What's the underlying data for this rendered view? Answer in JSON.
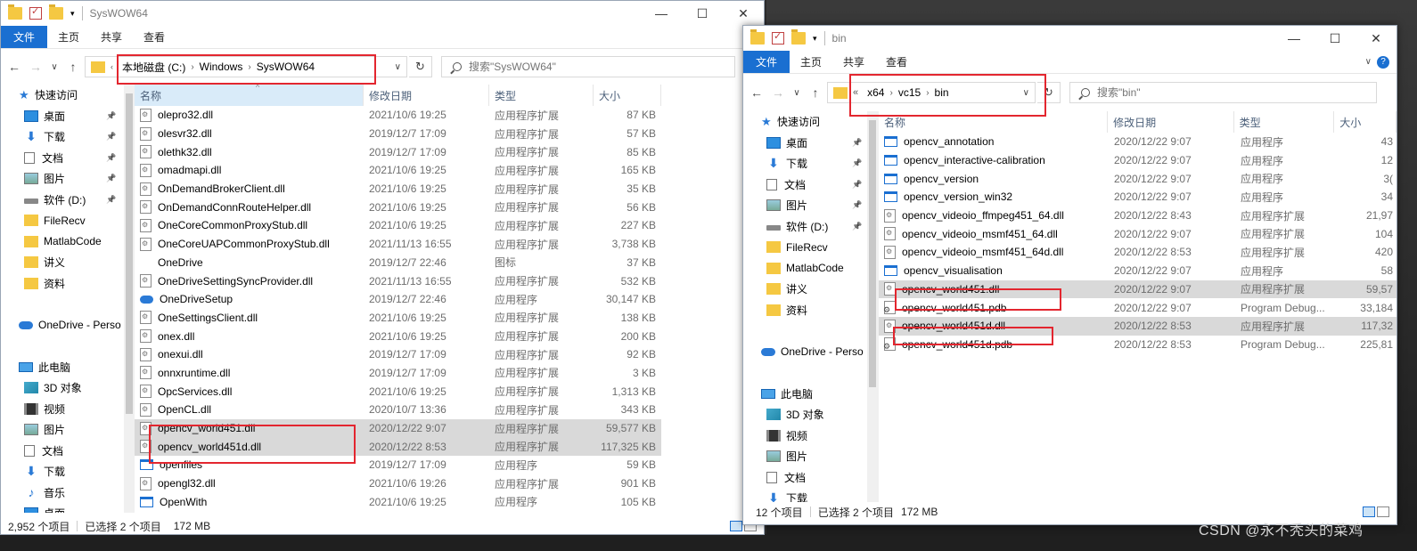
{
  "left_window": {
    "title": "SysWOW64",
    "ribbon": {
      "file": "文件",
      "tabs": [
        "主页",
        "共享",
        "查看"
      ]
    },
    "address": {
      "crumbs": [
        "本地磁盘 (C:)",
        "Windows",
        "SysWOW64"
      ]
    },
    "search_placeholder": "搜索\"SysWOW64\"",
    "columns": [
      "名称",
      "修改日期",
      "类型",
      "大小"
    ],
    "nav": [
      {
        "label": "快速访问",
        "icon": "star-icon",
        "pin": false
      },
      {
        "label": "桌面",
        "icon": "desktop-icon",
        "pin": true
      },
      {
        "label": "下载",
        "icon": "download-icon",
        "pin": true
      },
      {
        "label": "文档",
        "icon": "document-icon",
        "pin": true
      },
      {
        "label": "图片",
        "icon": "pictures-icon",
        "pin": true
      },
      {
        "label": "软件 (D:)",
        "icon": "drive-icon",
        "pin": true
      },
      {
        "label": "FileRecv",
        "icon": "folder-icon",
        "pin": false
      },
      {
        "label": "MatlabCode",
        "icon": "folder-icon",
        "pin": false
      },
      {
        "label": "讲义",
        "icon": "folder-icon",
        "pin": false
      },
      {
        "label": "资料",
        "icon": "folder-icon",
        "pin": false
      },
      {
        "label": "",
        "icon": "",
        "pin": false
      },
      {
        "label": "OneDrive - Perso",
        "icon": "cloud-icon",
        "pin": false
      },
      {
        "label": "",
        "icon": "",
        "pin": false
      },
      {
        "label": "此电脑",
        "icon": "pc-icon",
        "pin": false
      },
      {
        "label": "3D 对象",
        "icon": "3d-objects-icon",
        "pin": false
      },
      {
        "label": "视频",
        "icon": "video-icon",
        "pin": false
      },
      {
        "label": "图片",
        "icon": "pictures-icon",
        "pin": false
      },
      {
        "label": "文档",
        "icon": "document-icon",
        "pin": false
      },
      {
        "label": "下载",
        "icon": "download-icon",
        "pin": false
      },
      {
        "label": "音乐",
        "icon": "music-icon",
        "pin": false
      },
      {
        "label": "桌面",
        "icon": "desktop-icon",
        "pin": false
      }
    ],
    "files": [
      {
        "name": "olepro32.dll",
        "date": "2021/10/6 19:25",
        "type": "应用程序扩展",
        "size": "87 KB",
        "icon": "dll",
        "sel": false
      },
      {
        "name": "olesvr32.dll",
        "date": "2019/12/7 17:09",
        "type": "应用程序扩展",
        "size": "57 KB",
        "icon": "dll",
        "sel": false
      },
      {
        "name": "olethk32.dll",
        "date": "2019/12/7 17:09",
        "type": "应用程序扩展",
        "size": "85 KB",
        "icon": "dll",
        "sel": false
      },
      {
        "name": "omadmapi.dll",
        "date": "2021/10/6 19:25",
        "type": "应用程序扩展",
        "size": "165 KB",
        "icon": "dll",
        "sel": false
      },
      {
        "name": "OnDemandBrokerClient.dll",
        "date": "2021/10/6 19:25",
        "type": "应用程序扩展",
        "size": "35 KB",
        "icon": "dll",
        "sel": false
      },
      {
        "name": "OnDemandConnRouteHelper.dll",
        "date": "2021/10/6 19:25",
        "type": "应用程序扩展",
        "size": "56 KB",
        "icon": "dll",
        "sel": false
      },
      {
        "name": "OneCoreCommonProxyStub.dll",
        "date": "2021/10/6 19:25",
        "type": "应用程序扩展",
        "size": "227 KB",
        "icon": "dll",
        "sel": false
      },
      {
        "name": "OneCoreUAPCommonProxyStub.dll",
        "date": "2021/11/13 16:55",
        "type": "应用程序扩展",
        "size": "3,738 KB",
        "icon": "dll",
        "sel": false
      },
      {
        "name": "OneDrive",
        "date": "2019/12/7 22:46",
        "type": "图标",
        "size": "37 KB",
        "icon": "blank",
        "sel": false
      },
      {
        "name": "OneDriveSettingSyncProvider.dll",
        "date": "2021/11/13 16:55",
        "type": "应用程序扩展",
        "size": "532 KB",
        "icon": "dll",
        "sel": false
      },
      {
        "name": "OneDriveSetup",
        "date": "2019/12/7 22:46",
        "type": "应用程序",
        "size": "30,147 KB",
        "icon": "cloud",
        "sel": false
      },
      {
        "name": "OneSettingsClient.dll",
        "date": "2021/10/6 19:25",
        "type": "应用程序扩展",
        "size": "138 KB",
        "icon": "dll",
        "sel": false
      },
      {
        "name": "onex.dll",
        "date": "2021/10/6 19:25",
        "type": "应用程序扩展",
        "size": "200 KB",
        "icon": "dll",
        "sel": false
      },
      {
        "name": "onexui.dll",
        "date": "2019/12/7 17:09",
        "type": "应用程序扩展",
        "size": "92 KB",
        "icon": "dll",
        "sel": false
      },
      {
        "name": "onnxruntime.dll",
        "date": "2019/12/7 17:09",
        "type": "应用程序扩展",
        "size": "3 KB",
        "icon": "dll",
        "sel": false
      },
      {
        "name": "OpcServices.dll",
        "date": "2021/10/6 19:25",
        "type": "应用程序扩展",
        "size": "1,313 KB",
        "icon": "dll",
        "sel": false
      },
      {
        "name": "OpenCL.dll",
        "date": "2020/10/7 13:36",
        "type": "应用程序扩展",
        "size": "343 KB",
        "icon": "dll",
        "sel": false
      },
      {
        "name": "opencv_world451.dll",
        "date": "2020/12/22 9:07",
        "type": "应用程序扩展",
        "size": "59,577 KB",
        "icon": "dll",
        "sel": true
      },
      {
        "name": "opencv_world451d.dll",
        "date": "2020/12/22 8:53",
        "type": "应用程序扩展",
        "size": "117,325 KB",
        "icon": "dll",
        "sel": true
      },
      {
        "name": "openfiles",
        "date": "2019/12/7 17:09",
        "type": "应用程序",
        "size": "59 KB",
        "icon": "exe",
        "sel": false
      },
      {
        "name": "opengl32.dll",
        "date": "2021/10/6 19:26",
        "type": "应用程序扩展",
        "size": "901 KB",
        "icon": "dll",
        "sel": false
      },
      {
        "name": "OpenWith",
        "date": "2021/10/6 19:25",
        "type": "应用程序",
        "size": "105 KB",
        "icon": "exe",
        "sel": false
      }
    ],
    "status": {
      "count": "2,952 个项目",
      "selected": "已选择 2 个项目",
      "size": "172 MB"
    }
  },
  "right_window": {
    "title": "bin",
    "ribbon": {
      "file": "文件",
      "tabs": [
        "主页",
        "共享",
        "查看"
      ]
    },
    "address": {
      "prefix": "«",
      "crumbs": [
        "x64",
        "vc15",
        "bin"
      ]
    },
    "search_placeholder": "搜索\"bin\"",
    "columns": [
      "名称",
      "修改日期",
      "类型",
      "大小"
    ],
    "nav": [
      {
        "label": "快速访问",
        "icon": "star-icon",
        "pin": false
      },
      {
        "label": "桌面",
        "icon": "desktop-icon",
        "pin": true
      },
      {
        "label": "下载",
        "icon": "download-icon",
        "pin": true
      },
      {
        "label": "文档",
        "icon": "document-icon",
        "pin": true
      },
      {
        "label": "图片",
        "icon": "pictures-icon",
        "pin": true
      },
      {
        "label": "软件 (D:)",
        "icon": "drive-icon",
        "pin": true
      },
      {
        "label": "FileRecv",
        "icon": "folder-icon",
        "pin": false
      },
      {
        "label": "MatlabCode",
        "icon": "folder-icon",
        "pin": false
      },
      {
        "label": "讲义",
        "icon": "folder-icon",
        "pin": false
      },
      {
        "label": "资料",
        "icon": "folder-icon",
        "pin": false
      },
      {
        "label": "",
        "icon": "",
        "pin": false
      },
      {
        "label": "OneDrive - Perso",
        "icon": "cloud-icon",
        "pin": false
      },
      {
        "label": "",
        "icon": "",
        "pin": false
      },
      {
        "label": "此电脑",
        "icon": "pc-icon",
        "pin": false
      },
      {
        "label": "3D 对象",
        "icon": "3d-objects-icon",
        "pin": false
      },
      {
        "label": "视频",
        "icon": "video-icon",
        "pin": false
      },
      {
        "label": "图片",
        "icon": "pictures-icon",
        "pin": false
      },
      {
        "label": "文档",
        "icon": "document-icon",
        "pin": false
      },
      {
        "label": "下载",
        "icon": "download-icon",
        "pin": false
      }
    ],
    "files": [
      {
        "name": "opencv_annotation",
        "date": "2020/12/22 9:07",
        "type": "应用程序",
        "size": "43",
        "icon": "exe",
        "sel": false
      },
      {
        "name": "opencv_interactive-calibration",
        "date": "2020/12/22 9:07",
        "type": "应用程序",
        "size": "12",
        "icon": "exe",
        "sel": false
      },
      {
        "name": "opencv_version",
        "date": "2020/12/22 9:07",
        "type": "应用程序",
        "size": "3(",
        "icon": "exe",
        "sel": false
      },
      {
        "name": "opencv_version_win32",
        "date": "2020/12/22 9:07",
        "type": "应用程序",
        "size": "34",
        "icon": "exe",
        "sel": false
      },
      {
        "name": "opencv_videoio_ffmpeg451_64.dll",
        "date": "2020/12/22 8:43",
        "type": "应用程序扩展",
        "size": "21,97",
        "icon": "dll",
        "sel": false
      },
      {
        "name": "opencv_videoio_msmf451_64.dll",
        "date": "2020/12/22 9:07",
        "type": "应用程序扩展",
        "size": "104",
        "icon": "dll",
        "sel": false
      },
      {
        "name": "opencv_videoio_msmf451_64d.dll",
        "date": "2020/12/22 8:53",
        "type": "应用程序扩展",
        "size": "420",
        "icon": "dll",
        "sel": false
      },
      {
        "name": "opencv_visualisation",
        "date": "2020/12/22 9:07",
        "type": "应用程序",
        "size": "58",
        "icon": "exe",
        "sel": false
      },
      {
        "name": "opencv_world451.dll",
        "date": "2020/12/22 9:07",
        "type": "应用程序扩展",
        "size": "59,57",
        "icon": "dll",
        "sel": true
      },
      {
        "name": "opencv_world451.pdb",
        "date": "2020/12/22 9:07",
        "type": "Program Debug...",
        "size": "33,184",
        "icon": "pdb",
        "sel": false
      },
      {
        "name": "opencv_world451d.dll",
        "date": "2020/12/22 8:53",
        "type": "应用程序扩展",
        "size": "117,32",
        "icon": "dll",
        "sel": true
      },
      {
        "name": "opencv_world451d.pdb",
        "date": "2020/12/22 8:53",
        "type": "Program Debug...",
        "size": "225,81",
        "icon": "pdb",
        "sel": false
      }
    ],
    "status": {
      "count": "12 个项目",
      "selected": "已选择 2 个项目",
      "size": "172 MB"
    }
  },
  "watermark": "CSDN @永不秃头的菜鸡",
  "colors": {
    "accent": "#1a6fd1",
    "highlight": "#e3262f",
    "selected_row": "#d9d9d9"
  }
}
